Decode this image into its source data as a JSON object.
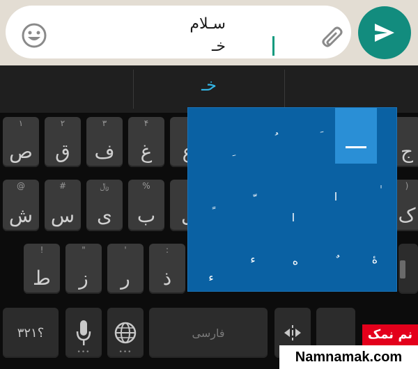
{
  "compose": {
    "line1": "سـلام",
    "line2": "خـ"
  },
  "suggestion": "خـ",
  "row1": [
    {
      "hint": "۱",
      "label": "ص"
    },
    {
      "hint": "۲",
      "label": "ق"
    },
    {
      "hint": "۳",
      "label": "ف"
    },
    {
      "hint": "۴",
      "label": "غ"
    },
    {
      "hint": "",
      "label": "ع"
    },
    {
      "hint": "",
      "label": "ج"
    }
  ],
  "row2": [
    {
      "hint": "@",
      "label": "ش"
    },
    {
      "hint": "#",
      "label": "س"
    },
    {
      "hint": "﷼",
      "label": "ی"
    },
    {
      "hint": "%",
      "label": "ب"
    },
    {
      "hint": "",
      "label": "ل"
    },
    {
      "hint": ")",
      "label": "ک"
    }
  ],
  "row3": [
    {
      "hint": "!",
      "label": "ط"
    },
    {
      "hint": "\"",
      "label": "ز"
    },
    {
      "hint": "'",
      "label": "ر"
    },
    {
      "hint": ":",
      "label": "ذ"
    }
  ],
  "bottom": {
    "symbols_label": "؟۳۲۱",
    "space_label": "فارسی"
  },
  "popup_marks": [
    "ـ",
    "َ",
    "ُ",
    "ِ",
    "ً",
    "ٌ",
    "ٍ",
    "ّ",
    "ا",
    "ٰ",
    "ٓ",
    "ٔ",
    "ء",
    "ه",
    "ۀ"
  ],
  "watermark": {
    "brand_fa": "نم نمک",
    "site": "Namnamak.com"
  },
  "colors": {
    "send": "#128c7e",
    "popup": "#0a61a3",
    "popup_selected": "#2a8fd6",
    "suggestion": "#33b5e5",
    "caret": "#0f9a7e"
  },
  "icons": [
    "emoji-icon",
    "paperclip-icon",
    "send-icon",
    "mic-icon",
    "globe-icon",
    "cursor-move-icon"
  ]
}
